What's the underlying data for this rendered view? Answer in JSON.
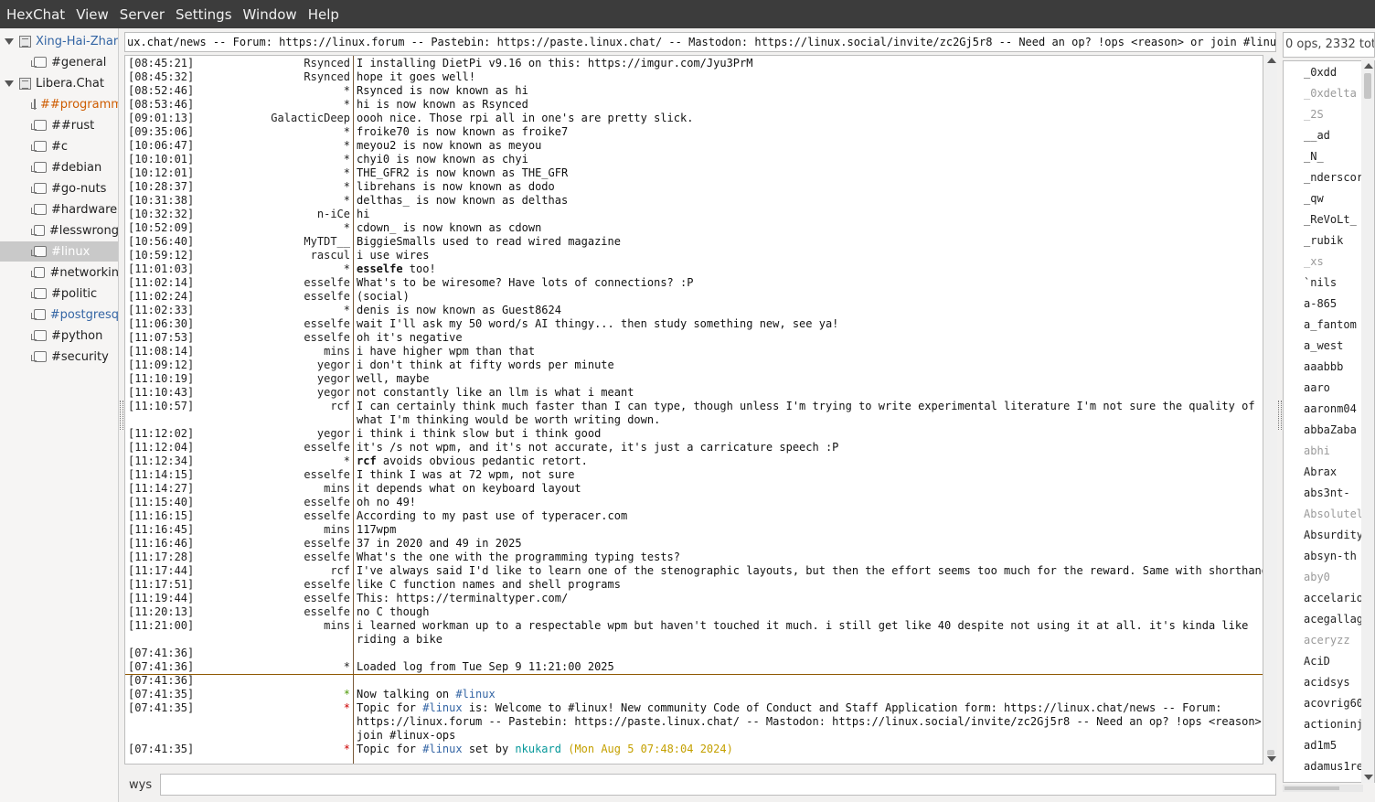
{
  "menubar": [
    "HexChat",
    "View",
    "Server",
    "Settings",
    "Window",
    "Help"
  ],
  "tree": [
    {
      "type": "server",
      "label": "Xing-Hai-Zhar",
      "color": "blue"
    },
    {
      "type": "channel",
      "label": "#general",
      "color": "default"
    },
    {
      "type": "server",
      "label": "Libera.Chat",
      "color": "default"
    },
    {
      "type": "channel",
      "label": "##programm",
      "color": "orange"
    },
    {
      "type": "channel",
      "label": "##rust",
      "color": "default"
    },
    {
      "type": "channel",
      "label": "#c",
      "color": "default"
    },
    {
      "type": "channel",
      "label": "#debian",
      "color": "default"
    },
    {
      "type": "channel",
      "label": "#go-nuts",
      "color": "default"
    },
    {
      "type": "channel",
      "label": "#hardware",
      "color": "default"
    },
    {
      "type": "channel",
      "label": "#lesswrong",
      "color": "default"
    },
    {
      "type": "channel",
      "label": "#linux",
      "color": "default",
      "selected": true
    },
    {
      "type": "channel",
      "label": "#networkin",
      "color": "default"
    },
    {
      "type": "channel",
      "label": "#politic",
      "color": "default"
    },
    {
      "type": "channel",
      "label": "#postgresq",
      "color": "blue"
    },
    {
      "type": "channel",
      "label": "#python",
      "color": "default"
    },
    {
      "type": "channel",
      "label": "#security",
      "color": "default"
    }
  ],
  "topic": "ux.chat/news -- Forum: https://linux.forum -- Pastebin: https://paste.linux.chat/ -- Mastodon: https://linux.social/invite/zc2Gj5r8 -- Need an op? !ops <reason> or join #linux-ops",
  "chat_lines": [
    {
      "ts": "[08:45:21]",
      "nick": "Rsynced",
      "msg": "I installing DietPi v9.16 on this: https://imgur.com/Jyu3PrM"
    },
    {
      "ts": "[08:45:32]",
      "nick": "Rsynced",
      "msg": "hope it goes well!"
    },
    {
      "ts": "[08:52:46]",
      "nick": "*",
      "msg": "Rsynced is now known as hi"
    },
    {
      "ts": "[08:53:46]",
      "nick": "*",
      "msg": "hi is now known as Rsynced"
    },
    {
      "ts": "[09:01:13]",
      "nick": "GalacticDeep",
      "msg": "oooh nice. Those rpi all in one's are pretty slick."
    },
    {
      "ts": "[09:35:06]",
      "nick": "*",
      "msg": "froike70 is now known as froike7"
    },
    {
      "ts": "[10:06:47]",
      "nick": "*",
      "msg": "meyou2 is now known as meyou"
    },
    {
      "ts": "[10:10:01]",
      "nick": "*",
      "msg": "chyi0 is now known as chyi"
    },
    {
      "ts": "[10:12:01]",
      "nick": "*",
      "msg": "THE_GFR2 is now known as THE_GFR"
    },
    {
      "ts": "[10:28:37]",
      "nick": "*",
      "msg": "librehans is now known as dodo"
    },
    {
      "ts": "[10:31:38]",
      "nick": "*",
      "msg": "delthas_ is now known as delthas"
    },
    {
      "ts": "[10:32:32]",
      "nick": "n-iCe",
      "msg": "hi"
    },
    {
      "ts": "[10:52:09]",
      "nick": "*",
      "msg": "cdown_ is now known as cdown"
    },
    {
      "ts": "[10:56:40]",
      "nick": "MyTDT__",
      "msg": "BiggieSmalls used to read wired magazine"
    },
    {
      "ts": "[10:59:12]",
      "nick": "rascul",
      "msg": "i use wires"
    },
    {
      "ts": "[11:01:03]",
      "nick": "*",
      "bold": "esselfe",
      "msg": " too!"
    },
    {
      "ts": "[11:02:14]",
      "nick": "esselfe",
      "msg": "What's to be wiresome? Have lots of connections? :P"
    },
    {
      "ts": "[11:02:24]",
      "nick": "esselfe",
      "msg": "(social)"
    },
    {
      "ts": "[11:02:33]",
      "nick": "*",
      "msg": "denis is now known as Guest8624"
    },
    {
      "ts": "[11:06:30]",
      "nick": "esselfe",
      "msg": "wait I'll ask my 50 word/s AI thingy... then study something new, see ya!"
    },
    {
      "ts": "[11:07:53]",
      "nick": "esselfe",
      "msg": "oh it's negative"
    },
    {
      "ts": "[11:08:14]",
      "nick": "mins",
      "msg": "i have higher wpm than that"
    },
    {
      "ts": "[11:09:12]",
      "nick": "yegor",
      "msg": "i don't think at fifty words per minute"
    },
    {
      "ts": "[11:10:19]",
      "nick": "yegor",
      "msg": "well, maybe"
    },
    {
      "ts": "[11:10:43]",
      "nick": "yegor",
      "msg": "not constantly like an llm is what i meant"
    },
    {
      "ts": "[11:10:57]",
      "nick": "rcf",
      "msg": "I can certainly think much faster than I can type, though unless I'm trying to write experimental literature I'm not sure the quality of"
    },
    {
      "ts": "",
      "nick": "",
      "msg": "what I'm thinking would be worth writing down."
    },
    {
      "ts": "[11:12:02]",
      "nick": "yegor",
      "msg": "i think i think slow but i think good"
    },
    {
      "ts": "[11:12:04]",
      "nick": "esselfe",
      "msg": "it's /s not wpm, and it's not accurate, it's just a carricature speech :P"
    },
    {
      "ts": "[11:12:34]",
      "nick": "*",
      "bold": "rcf",
      "msg": " avoids obvious pedantic retort."
    },
    {
      "ts": "[11:14:15]",
      "nick": "esselfe",
      "msg": "I think I was at 72 wpm, not sure"
    },
    {
      "ts": "[11:14:27]",
      "nick": "mins",
      "msg": "it depends what on keyboard layout"
    },
    {
      "ts": "[11:15:40]",
      "nick": "esselfe",
      "msg": "oh no 49!"
    },
    {
      "ts": "[11:16:15]",
      "nick": "esselfe",
      "msg": "According to my past use of typeracer.com"
    },
    {
      "ts": "[11:16:45]",
      "nick": "mins",
      "msg": "117wpm"
    },
    {
      "ts": "[11:16:46]",
      "nick": "esselfe",
      "msg": "37 in 2020 and 49 in 2025"
    },
    {
      "ts": "[11:17:28]",
      "nick": "esselfe",
      "msg": "What's the one with the programming typing tests?"
    },
    {
      "ts": "[11:17:44]",
      "nick": "rcf",
      "msg": "I've always said I'd like to learn one of the stenographic layouts, but then the effort seems too much for the reward. Same with shorthand."
    },
    {
      "ts": "[11:17:51]",
      "nick": "esselfe",
      "msg": "like C function names and shell programs"
    },
    {
      "ts": "[11:19:44]",
      "nick": "esselfe",
      "msg": "This: https://terminaltyper.com/"
    },
    {
      "ts": "[11:20:13]",
      "nick": "esselfe",
      "msg": "no C though"
    },
    {
      "ts": "[11:21:00]",
      "nick": "mins",
      "msg": "i learned workman up to a respectable wpm but haven't touched it much. i still get like 40 despite not using it at all. it's kinda like"
    },
    {
      "ts": "",
      "nick": "",
      "msg": "riding a bike"
    },
    {
      "ts": "[07:41:36]",
      "nick": "",
      "msg": ""
    },
    {
      "ts": "[07:41:36]",
      "nick": "*",
      "msg": "Loaded log from Tue Sep  9 11:21:00 2025"
    },
    {
      "ts": "[07:41:36]",
      "nick": "",
      "msg": ""
    }
  ],
  "status_lines": {
    "talking": {
      "ts": "[07:41:35]",
      "prefix": "Now talking on ",
      "channel": "#linux"
    },
    "topic": {
      "ts": "[07:41:35]",
      "prefix": "Topic for ",
      "channel": "#linux",
      "line1": " is: Welcome to #linux! New community Code of Conduct and Staff Application form: https://linux.chat/news -- Forum:",
      "line2": "https://linux.forum -- Pastebin: https://paste.linux.chat/ -- Mastodon: https://linux.social/invite/zc2Gj5r8 -- Need an op? !ops <reason> or",
      "line3": "join #linux-ops"
    },
    "setby": {
      "ts": "[07:41:35]",
      "prefix": "Topic for ",
      "channel": "#linux",
      "mid": " set by ",
      "nick": "nkukard",
      "open": " (",
      "date": "Mon Aug  5 07:48:04 2024",
      "close": ")"
    }
  },
  "input": {
    "nick": "wys",
    "value": ""
  },
  "user_count": "0 ops, 2332 tot",
  "users": [
    {
      "name": "_0xdd",
      "away": false
    },
    {
      "name": "_0xdelta",
      "away": true
    },
    {
      "name": "_2S",
      "away": true
    },
    {
      "name": "__ad",
      "away": false
    },
    {
      "name": "_N_",
      "away": false
    },
    {
      "name": "_nderscor",
      "away": false
    },
    {
      "name": "_qw",
      "away": false
    },
    {
      "name": "_ReVoLt_",
      "away": false
    },
    {
      "name": "_rubik",
      "away": false
    },
    {
      "name": "_xs",
      "away": true
    },
    {
      "name": "`nils",
      "away": false
    },
    {
      "name": "a-865",
      "away": false
    },
    {
      "name": "a_fantom",
      "away": false
    },
    {
      "name": "a_west",
      "away": false
    },
    {
      "name": "aaabbb",
      "away": false
    },
    {
      "name": "aaro",
      "away": false
    },
    {
      "name": "aaronm04",
      "away": false
    },
    {
      "name": "abbaZaba",
      "away": false
    },
    {
      "name": "abhi",
      "away": true
    },
    {
      "name": "Abrax",
      "away": false
    },
    {
      "name": "abs3nt-",
      "away": false
    },
    {
      "name": "Absolutel",
      "away": true
    },
    {
      "name": "Absurdity",
      "away": false
    },
    {
      "name": "absyn-th",
      "away": false
    },
    {
      "name": "aby0",
      "away": true
    },
    {
      "name": "accelario",
      "away": false
    },
    {
      "name": "acegallag",
      "away": false
    },
    {
      "name": "aceryzz",
      "away": true
    },
    {
      "name": "AciD",
      "away": false
    },
    {
      "name": "acidsys",
      "away": false
    },
    {
      "name": "acovrig60",
      "away": false
    },
    {
      "name": "actioninj",
      "away": false
    },
    {
      "name": "ad1m5",
      "away": false
    },
    {
      "name": "adamus1re",
      "away": false
    }
  ]
}
